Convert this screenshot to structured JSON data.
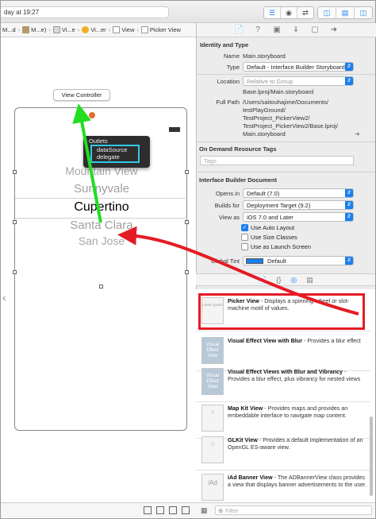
{
  "toolbar": {
    "status": "day at 19:27"
  },
  "jumpbar": {
    "items": [
      "M...d",
      "M...e)",
      "Vi...e",
      "Vi...er",
      "View",
      "Picker View"
    ]
  },
  "canvas": {
    "vc_label": "View Controller",
    "picker_rows": [
      "Mountain View",
      "Sunnyvale",
      "Cupertino",
      "Santa Clara",
      "San Jose"
    ],
    "outlets": {
      "title": "Outlets",
      "items": [
        "dataSource",
        "delegate"
      ]
    }
  },
  "inspector": {
    "identity": {
      "title": "Identity and Type",
      "name_label": "Name",
      "name_value": "Main.storyboard",
      "type_label": "Type",
      "type_value": "Default - Interface Builder Storyboard",
      "location_label": "Location",
      "location_value": "Relative to Group",
      "location_file": "Base.lproj/Main.storyboard",
      "fullpath_label": "Full Path",
      "fullpath_value": [
        "/Users/saitouhajime/Documents/",
        "testPlayGround/",
        "TestProject_PickerView2/",
        "TestProject_PickerView2/Base.lproj/",
        "Main.storyboard"
      ]
    },
    "odr": {
      "title": "On Demand Resource Tags",
      "tags_placeholder": "Tags"
    },
    "ibdoc": {
      "title": "Interface Builder Document",
      "opens_in_label": "Opens in",
      "opens_in_value": "Default (7.0)",
      "builds_for_label": "Builds for",
      "builds_for_value": "Deployment Target (9.2)",
      "view_as_label": "View as",
      "view_as_value": "iOS 7.0 and Later",
      "auto_layout": "Use Auto Layout",
      "size_classes": "Use Size Classes",
      "launch_screen": "Use as Launch Screen",
      "global_tint_label": "Global Tint",
      "global_tint_value": "Default"
    }
  },
  "library": {
    "items": [
      {
        "thumb": "Lorem ipsum",
        "title": "Picker View",
        "desc": " - Displays a spinning-wheel or slot-machine motif of values."
      },
      {
        "thumb": "Visual Effect View",
        "title": "Visual Effect View with Blur",
        "desc": " - Provides a blur effect"
      },
      {
        "thumb": "Visual Effect View",
        "title": "Visual Effect Views with Blur and Vibrancy",
        "desc": " - Provides a blur effect, plus vibrancy for nested views"
      },
      {
        "thumb": "",
        "title": "Map Kit View",
        "desc": " - Provides maps and provides an embeddable interface to navigate map content."
      },
      {
        "thumb": "",
        "title": "GLKit View",
        "desc": " - Provides a default implementation of an OpenGL ES-aware view."
      },
      {
        "thumb": "iAd",
        "title": "iAd Banner View",
        "desc": " - The ADBannerView class provides a view that displays banner advertisements to the user."
      }
    ],
    "filter_placeholder": "Filter"
  },
  "colors": {
    "accent": "#1a7ff0",
    "annotation_red": "#e51b24",
    "annotation_green": "#22dd22",
    "highlight_cyan": "#33c6e6"
  }
}
